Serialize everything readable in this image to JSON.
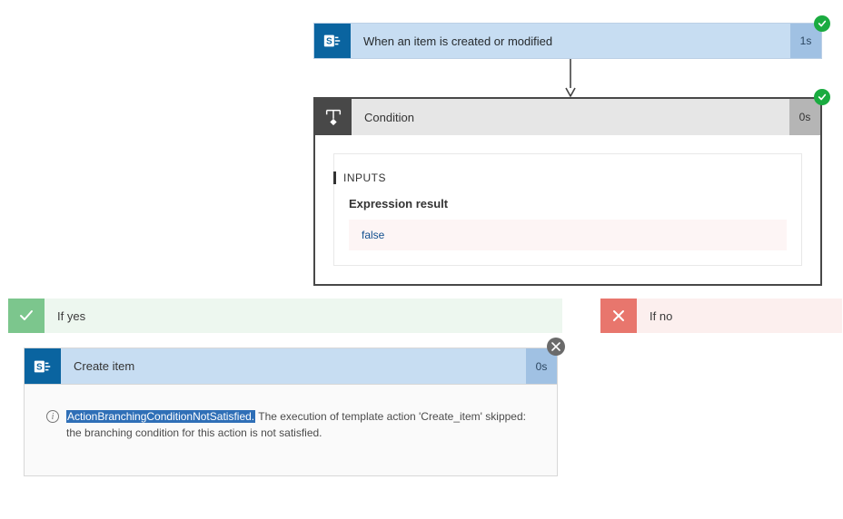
{
  "trigger": {
    "title": "When an item is created or modified",
    "duration": "1s",
    "status": "success"
  },
  "condition": {
    "title": "Condition",
    "duration": "0s",
    "status": "success",
    "inputs_label": "INPUTS",
    "expression_label": "Expression result",
    "expression_value": "false"
  },
  "branches": {
    "yes_label": "If yes",
    "no_label": "If no"
  },
  "create_item": {
    "title": "Create item",
    "duration": "0s",
    "status": "skipped",
    "message_highlight": "ActionBranchingConditionNotSatisfied.",
    "message_rest": " The execution of template action 'Create_item' skipped: the branching condition for this action is not satisfied."
  }
}
